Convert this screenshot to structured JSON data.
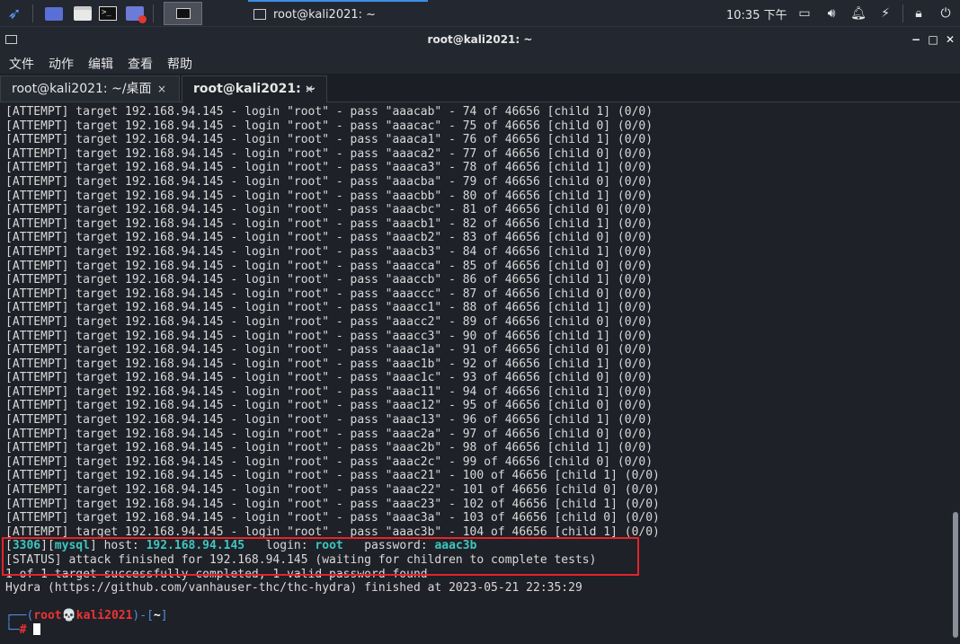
{
  "panel": {
    "clock": "10:35 下午",
    "taskbar_window_title": "root@kali2021: ~"
  },
  "window": {
    "title": "root@kali2021: ~",
    "minimize": "−",
    "maximize": "□",
    "close": "✕"
  },
  "menu": [
    "文件",
    "动作",
    "编辑",
    "查看",
    "帮助"
  ],
  "tabs": [
    {
      "label": "root@kali2021: ~/桌面",
      "close": "×"
    },
    {
      "label": "root@kali2021: ~",
      "close": "×"
    }
  ],
  "terminal": {
    "attempt_prefix": "[ATTEMPT] target 192.168.94.145 - login \"root\" - pass ",
    "attempts": [
      {
        "pass": "aaacab",
        "n": "74",
        "child": "1"
      },
      {
        "pass": "aaacac",
        "n": "75",
        "child": "0"
      },
      {
        "pass": "aaaca1",
        "n": "76",
        "child": "1"
      },
      {
        "pass": "aaaca2",
        "n": "77",
        "child": "0"
      },
      {
        "pass": "aaaca3",
        "n": "78",
        "child": "1"
      },
      {
        "pass": "aaacba",
        "n": "79",
        "child": "0"
      },
      {
        "pass": "aaacbb",
        "n": "80",
        "child": "1"
      },
      {
        "pass": "aaacbc",
        "n": "81",
        "child": "0"
      },
      {
        "pass": "aaacb1",
        "n": "82",
        "child": "1"
      },
      {
        "pass": "aaacb2",
        "n": "83",
        "child": "0"
      },
      {
        "pass": "aaacb3",
        "n": "84",
        "child": "1"
      },
      {
        "pass": "aaacca",
        "n": "85",
        "child": "0"
      },
      {
        "pass": "aaaccb",
        "n": "86",
        "child": "1"
      },
      {
        "pass": "aaaccc",
        "n": "87",
        "child": "0"
      },
      {
        "pass": "aaacc1",
        "n": "88",
        "child": "1"
      },
      {
        "pass": "aaacc2",
        "n": "89",
        "child": "0"
      },
      {
        "pass": "aaacc3",
        "n": "90",
        "child": "1"
      },
      {
        "pass": "aaac1a",
        "n": "91",
        "child": "0"
      },
      {
        "pass": "aaac1b",
        "n": "92",
        "child": "1"
      },
      {
        "pass": "aaac1c",
        "n": "93",
        "child": "0"
      },
      {
        "pass": "aaac11",
        "n": "94",
        "child": "1"
      },
      {
        "pass": "aaac12",
        "n": "95",
        "child": "0"
      },
      {
        "pass": "aaac13",
        "n": "96",
        "child": "1"
      },
      {
        "pass": "aaac2a",
        "n": "97",
        "child": "0"
      },
      {
        "pass": "aaac2b",
        "n": "98",
        "child": "1"
      },
      {
        "pass": "aaac2c",
        "n": "99",
        "child": "0"
      },
      {
        "pass": "aaac21",
        "n": "100",
        "child": "1"
      },
      {
        "pass": "aaac22",
        "n": "101",
        "child": "0"
      },
      {
        "pass": "aaac23",
        "n": "102",
        "child": "1"
      },
      {
        "pass": "aaac3a",
        "n": "103",
        "child": "0"
      },
      {
        "pass": "aaac3b",
        "n": "104",
        "child": "1"
      }
    ],
    "total": "46656",
    "result": {
      "port": "3306",
      "service": "mysql",
      "host_label": "host:",
      "host": "192.168.94.145",
      "login_label": "login:",
      "login": "root",
      "password_label": "password:",
      "password": "aaac3b"
    },
    "status_line": "[STATUS] attack finished for 192.168.94.145 (waiting for children to complete tests)",
    "summary_line": "1 of 1 target successfully completed, 1 valid password found",
    "finish_line": "Hydra (https://github.com/vanhauser-thc/thc-hydra) finished at 2023-05-21 22:35:29",
    "prompt": {
      "user": "root",
      "host": "kali2021",
      "dir": "~",
      "symbol": "#"
    }
  }
}
